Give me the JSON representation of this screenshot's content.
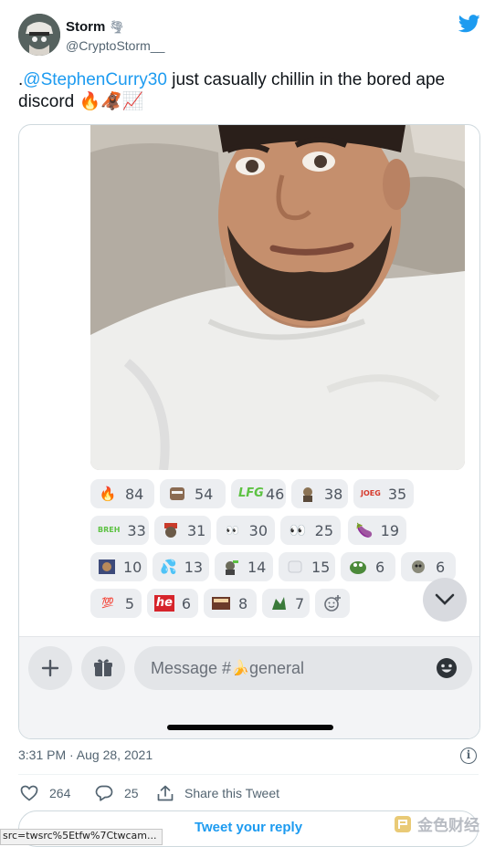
{
  "author": {
    "name": "Storm",
    "name_emoji": "tornado-icon",
    "handle": "@CryptoStorm__"
  },
  "tweet": {
    "prefix": ".",
    "mention": "@StephenCurry30",
    "text": " just casually chillin in the bored ape discord",
    "emojis": [
      "fire-icon",
      "monkey-icon",
      "chart-increasing-icon"
    ]
  },
  "reactions": [
    {
      "icon": "fire",
      "count": "84"
    },
    {
      "icon": "ape-sticker-1",
      "count": "54"
    },
    {
      "icon": "lfg-sticker",
      "count": "46"
    },
    {
      "icon": "ape-sticker-2",
      "count": "38"
    },
    {
      "icon": "joeg-sticker",
      "count": "35"
    },
    {
      "icon": "breh-sticker",
      "count": "33"
    },
    {
      "icon": "ape-sticker-3",
      "count": "31"
    },
    {
      "icon": "eyes-sticker",
      "count": "30"
    },
    {
      "icon": "eyes",
      "count": "25"
    },
    {
      "icon": "eggplant",
      "count": "19"
    },
    {
      "icon": "ape-sticker-4",
      "count": "10"
    },
    {
      "icon": "water-sticker",
      "count": "13"
    },
    {
      "icon": "ape-sticker-5",
      "count": "14"
    },
    {
      "icon": "sticker-6",
      "count": "15"
    },
    {
      "icon": "pepe-sticker",
      "count": "6"
    },
    {
      "icon": "ape-sticker-7",
      "count": "6"
    },
    {
      "icon": "hundred",
      "count": "5"
    },
    {
      "icon": "he-sticker",
      "count": "6"
    },
    {
      "icon": "daddy-sticker",
      "count": "8"
    },
    {
      "icon": "ape-sticker-8",
      "count": "7"
    }
  ],
  "discord": {
    "message_placeholder_prefix": "Message #",
    "channel": "general"
  },
  "meta": {
    "timestamp": "3:31 PM · Aug 28, 2021",
    "likes": "264",
    "replies": "25",
    "share_label": "Share this Tweet",
    "reply_button": "Tweet your reply"
  },
  "browser": {
    "status_url": "src=twsrc%5Etfw%7Ctwcam..."
  },
  "watermark": {
    "text": "金色财经"
  },
  "colors": {
    "twitter_blue": "#1d9bf0",
    "discord_pill": "#eceef1",
    "text_secondary": "#536471"
  }
}
